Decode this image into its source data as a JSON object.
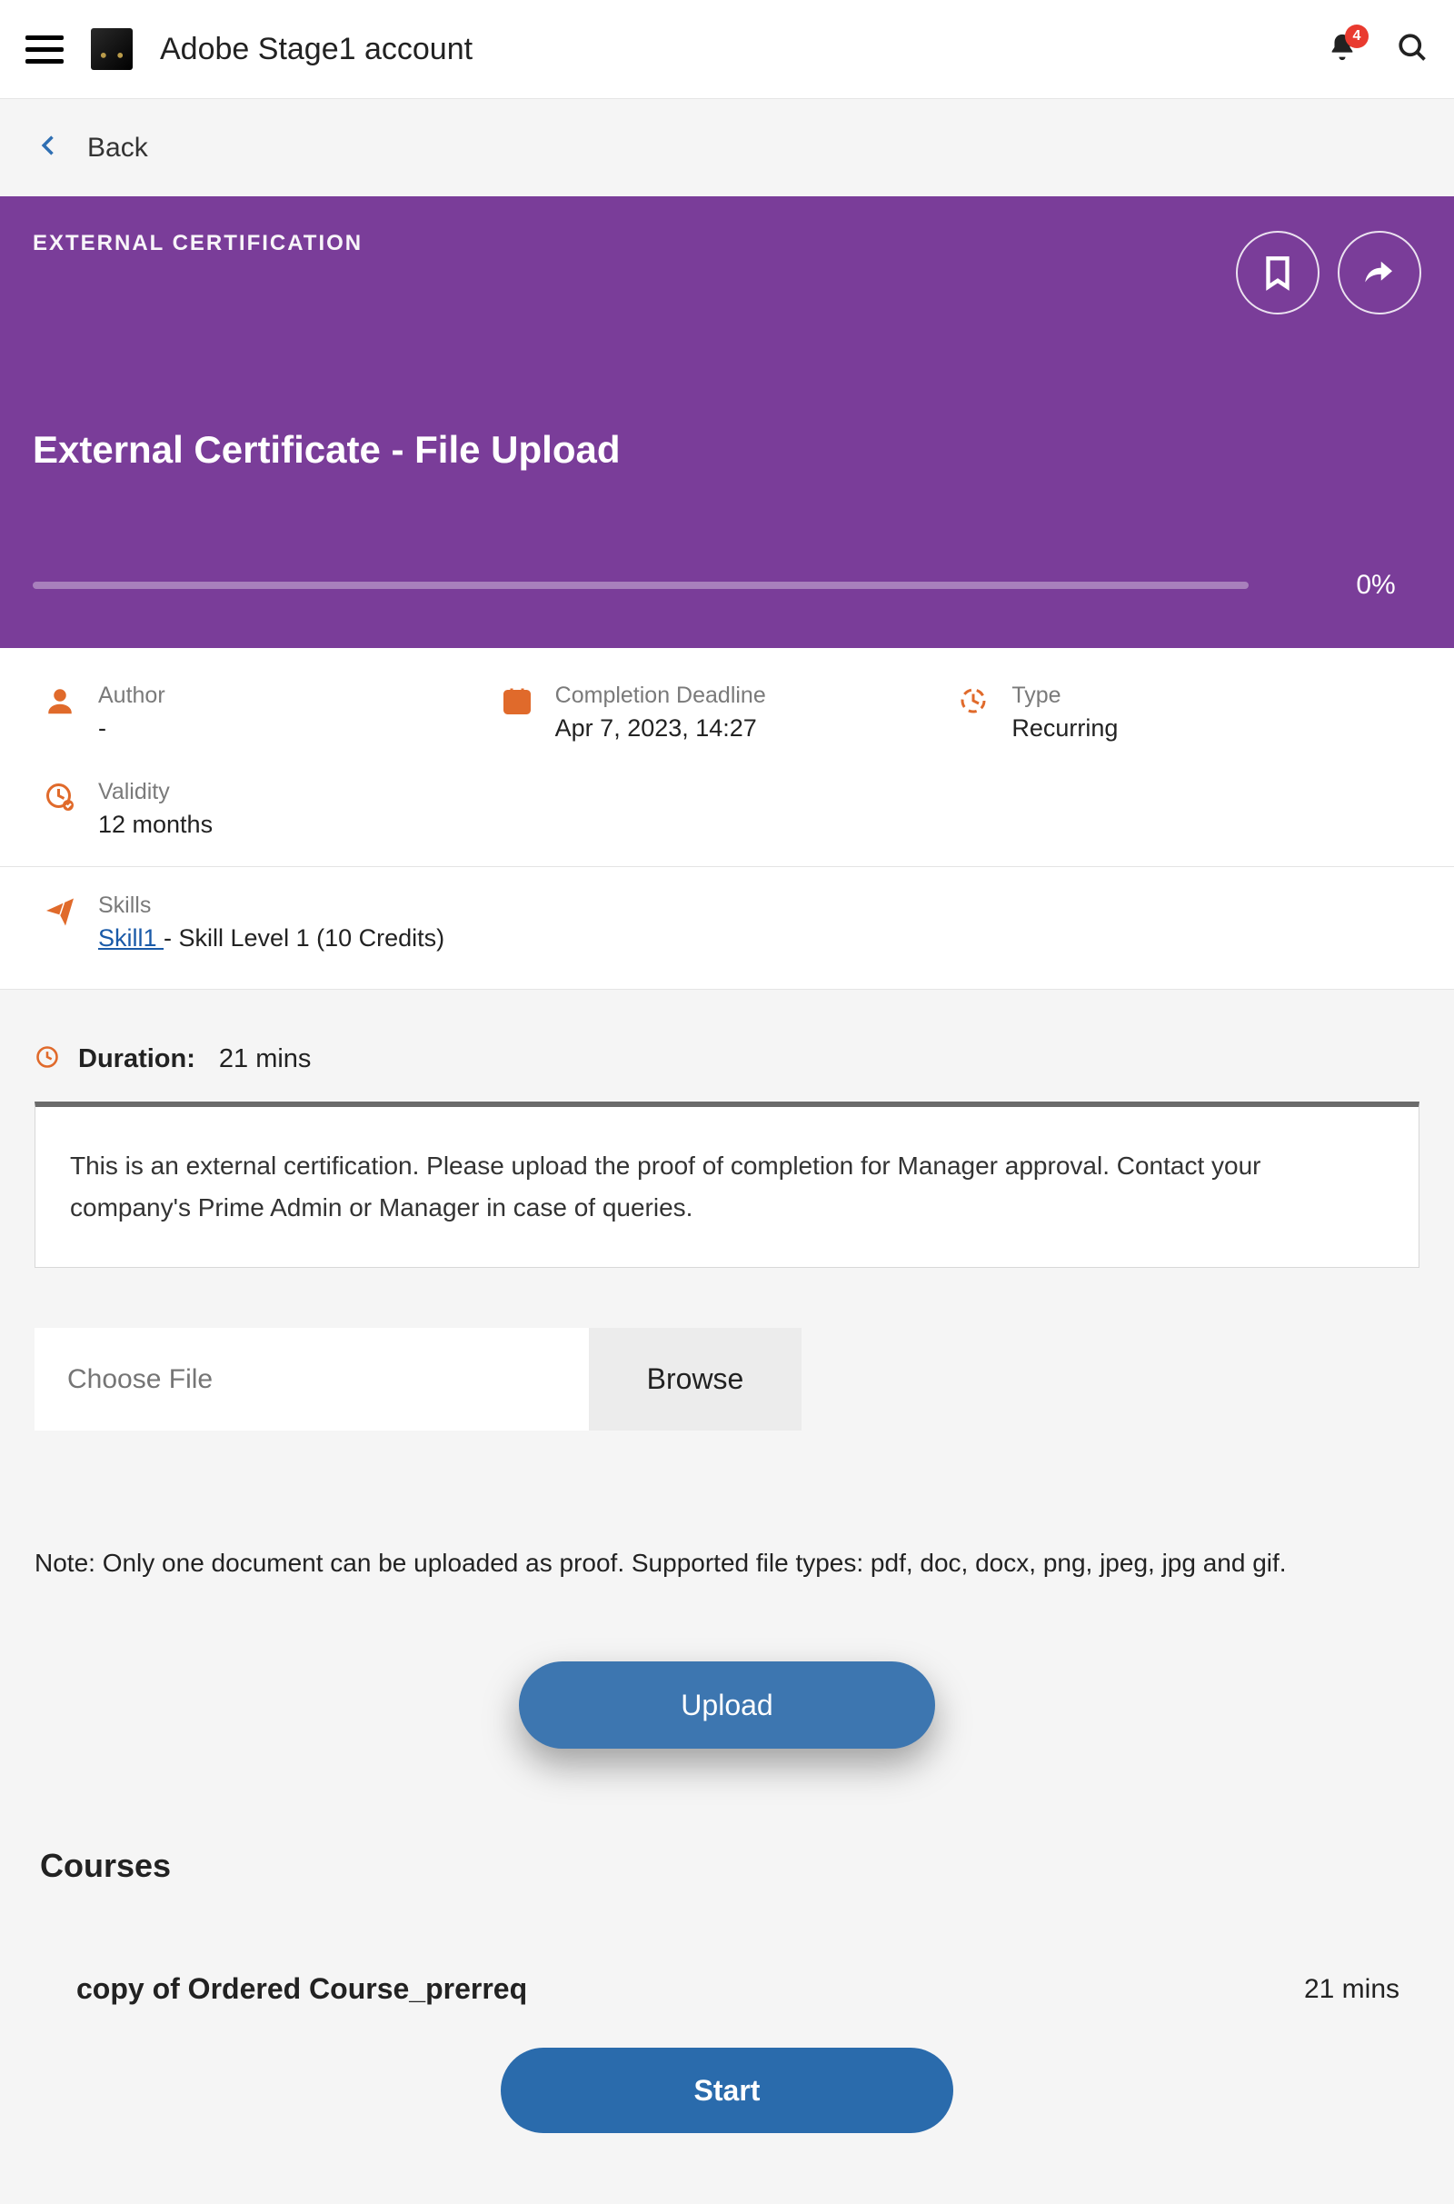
{
  "appbar": {
    "title": "Adobe Stage1 account",
    "notification_count": "4"
  },
  "backbar": {
    "label": "Back"
  },
  "hero": {
    "eyebrow": "EXTERNAL CERTIFICATION",
    "title": "External Certificate - File Upload",
    "progress_pct": "0%"
  },
  "meta": {
    "author": {
      "label": "Author",
      "value": "-"
    },
    "deadline": {
      "label": "Completion Deadline",
      "value": "Apr 7, 2023, 14:27"
    },
    "type": {
      "label": "Type",
      "value": "Recurring"
    },
    "validity": {
      "label": "Validity",
      "value": "12 months"
    }
  },
  "skills": {
    "label": "Skills",
    "link_text": "Skill1 ",
    "tail": "- Skill Level 1 (10 Credits)"
  },
  "duration": {
    "label": "Duration:",
    "value": "21 mins"
  },
  "info_card": "This is an external certification. Please upload the proof of completion for Manager approval. Contact your company's Prime Admin or Manager in case of queries.",
  "file": {
    "placeholder": "Choose File",
    "browse": "Browse",
    "note": "Note: Only one document can be uploaded as proof. Supported file types: pdf, doc, docx, png, jpeg, jpg and gif.",
    "upload": "Upload"
  },
  "courses": {
    "heading": "Courses",
    "item": {
      "name": "copy of Ordered Course_prerreq",
      "duration": "21 mins"
    },
    "start": "Start"
  }
}
